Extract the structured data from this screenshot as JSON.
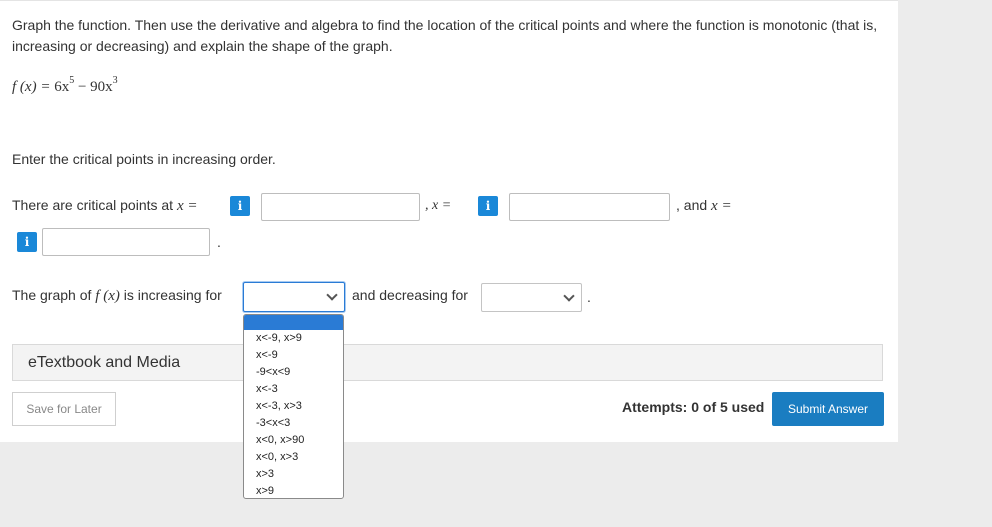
{
  "question": {
    "prompt": "Graph the function. Then use the derivative and algebra to find the location of the critical points and where the function is monotonic (that is, increasing or decreasing) and explain the shape of the graph.",
    "function": {
      "name": "f (x) = ",
      "c1": "6x",
      "e1": "5",
      "minus": " − 90x",
      "e2": "3"
    },
    "instruction": "Enter the critical points in increasing order."
  },
  "critical": {
    "label_start": "There are critical points at",
    "var": "x =",
    "sep2": ", x =",
    "sep3": ", and",
    "var3": "x =",
    "period": ".",
    "inputs": [
      "",
      "",
      ""
    ]
  },
  "monotonic": {
    "label_start": "The graph of",
    "func": "f (x)",
    "label_increasing": "is increasing for",
    "label_decreasing": "and decreasing for",
    "period": ".",
    "increasing_value": "",
    "decreasing_value": ""
  },
  "dropdown": {
    "options": [
      "x<-9, x>9",
      "x<-9",
      "-9<x<9",
      "x<-3",
      "x<-3, x>3",
      "-3<x<3",
      "x<0, x>90",
      "x<0, x>3",
      "x>3",
      "x>9"
    ]
  },
  "footer": {
    "etextbook": "eTextbook and Media",
    "save": "Save for Later",
    "attempts": "Attempts: 0 of 5 used",
    "submit": "Submit Answer"
  },
  "icons": {
    "info": "i"
  },
  "colors": {
    "accent": "#1a88d8",
    "submit": "#1a7dc1",
    "highlight": "#2a7bd5"
  }
}
